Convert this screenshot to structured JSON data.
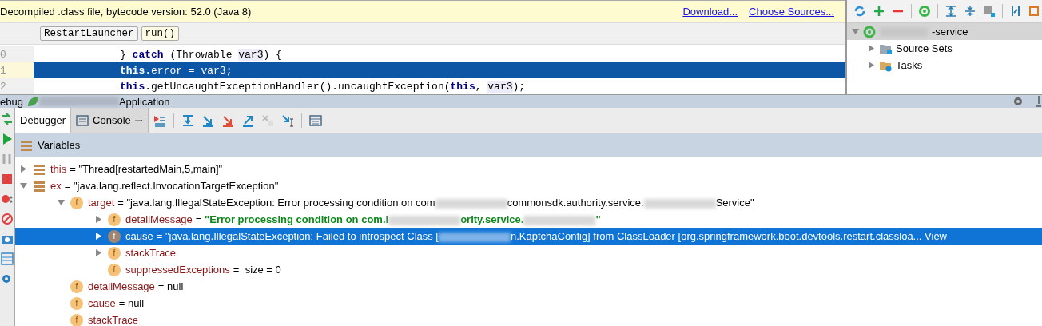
{
  "banner": {
    "text": "Decompiled .class file, bytecode version: 52.0 (Java 8)",
    "links": [
      "Download...",
      "Choose Sources..."
    ]
  },
  "breadcrumbs": [
    "RestartLauncher",
    "run()"
  ],
  "code_lines": [
    {
      "number": "0",
      "selected": false,
      "parts": [
        {
          "kind": "plain",
          "text": "} "
        },
        {
          "kind": "keyword",
          "text": "catch"
        },
        {
          "kind": "plain",
          "text": " (Throwable "
        },
        {
          "kind": "ref",
          "text": "var3"
        },
        {
          "kind": "plain",
          "text": ") {"
        }
      ]
    },
    {
      "number": "1",
      "selected": true,
      "parts": [
        {
          "kind": "keyword",
          "text": "this"
        },
        {
          "kind": "plain",
          "text": ".error = var3;"
        }
      ]
    },
    {
      "number": "2",
      "selected": false,
      "parts": [
        {
          "kind": "keyword",
          "text": "this"
        },
        {
          "kind": "plain",
          "text": ".getUncaughtExceptionHandler().uncaughtException("
        },
        {
          "kind": "keyword",
          "text": "this"
        },
        {
          "kind": "plain",
          "text": ", "
        },
        {
          "kind": "ref",
          "text": "var3"
        },
        {
          "kind": "plain",
          "text": ");"
        }
      ]
    }
  ],
  "gradle": {
    "tree": [
      {
        "label": "-service",
        "expanded": true,
        "selected": true,
        "blurred_prefix": true,
        "children": [
          {
            "label": "Source Sets",
            "kind": "sources",
            "expanded": false,
            "selected": false
          },
          {
            "label": "Tasks",
            "kind": "tasks",
            "expanded": false,
            "selected": false
          }
        ]
      }
    ]
  },
  "debug": {
    "title_prefix": "ebug",
    "title_suffix": "Application",
    "tabs": [
      {
        "label": "Debugger",
        "selected": true
      },
      {
        "label": "Console",
        "selected": false
      }
    ],
    "variables_title": "Variables",
    "variables": [
      {
        "kind": "variable",
        "name": "this",
        "value": [
          {
            "kind": "text",
            "text": "= \"Thread[restartedMain,5,main]\""
          }
        ],
        "expanded": false,
        "selected": false
      },
      {
        "kind": "variable",
        "name": "ex",
        "value": [
          {
            "kind": "text",
            "text": "= \"java.lang.reflect.InvocationTargetException\""
          }
        ],
        "expanded": true,
        "selected": false,
        "children": [
          {
            "kind": "field",
            "badge": "f",
            "name": "target",
            "value": [
              {
                "kind": "text",
                "text": "= \"java.lang.IllegalStateException: Error processing condition on com"
              },
              {
                "kind": "blur"
              },
              {
                "kind": "text",
                "text": "commonsdk.authority.service."
              },
              {
                "kind": "blur"
              },
              {
                "kind": "text",
                "text": "Service\""
              }
            ],
            "expanded": true,
            "selected": false,
            "children": [
              {
                "kind": "field",
                "badge": "f",
                "name": "detailMessage",
                "value": [
                  {
                    "kind": "text",
                    "text": "= "
                  },
                  {
                    "kind": "string",
                    "text": "\"Error processing condition on com.i"
                  },
                  {
                    "kind": "blur"
                  },
                  {
                    "kind": "string",
                    "text": "ority.service."
                  },
                  {
                    "kind": "blur"
                  },
                  {
                    "kind": "string",
                    "text": "\""
                  }
                ],
                "expanded": false,
                "selected": false
              },
              {
                "kind": "field",
                "badge": "f",
                "name": "cause",
                "value": [
                  {
                    "kind": "text",
                    "text": "= \"java.lang.IllegalStateException: Failed to introspect Class ["
                  },
                  {
                    "kind": "blur"
                  },
                  {
                    "kind": "text",
                    "text": "n.KaptchaConfig] from ClassLoader [org.springframework.boot.devtools.restart.classloa... View"
                  }
                ],
                "expanded": false,
                "selected": true
              },
              {
                "kind": "field",
                "badge": "f",
                "name": "stackTrace",
                "expanded": false,
                "selected": false
              },
              {
                "kind": "field",
                "badge": "f",
                "name": "suppressedExceptions",
                "value": [
                  {
                    "kind": "text",
                    "text": "=  size = 0"
                  }
                ],
                "selected": false
              }
            ]
          },
          {
            "kind": "field",
            "badge": "f",
            "name": "detailMessage",
            "value": [
              {
                "kind": "text",
                "text": "= null"
              }
            ],
            "selected": false
          },
          {
            "kind": "field",
            "badge": "f",
            "name": "cause",
            "value": [
              {
                "kind": "text",
                "text": "= null"
              }
            ],
            "selected": false
          },
          {
            "kind": "field",
            "badge": "f",
            "name": "stackTrace",
            "selected": false
          }
        ]
      }
    ]
  }
}
